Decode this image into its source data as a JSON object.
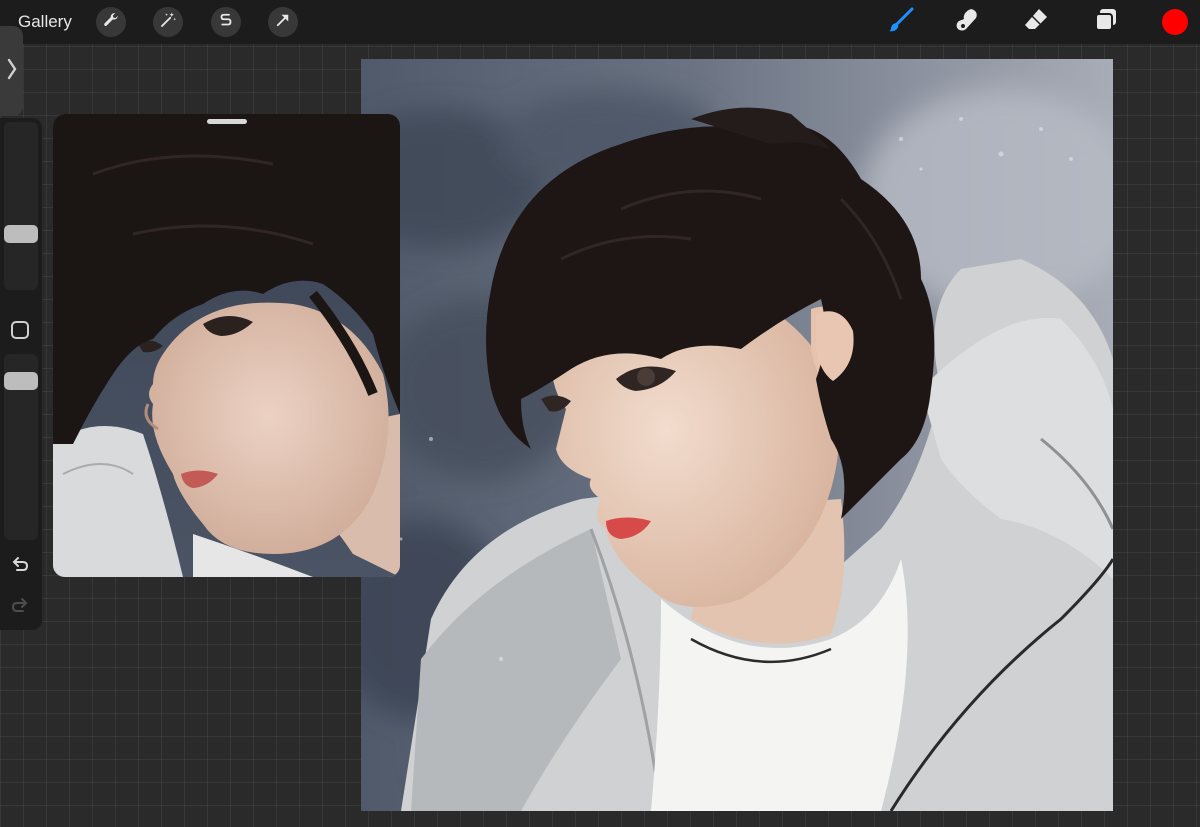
{
  "toolbar": {
    "gallery_label": "Gallery",
    "left_tools": [
      "wrench-icon",
      "magic-wand-icon",
      "selection-icon",
      "transform-arrow-icon"
    ],
    "right_tools": [
      "brush-icon",
      "smudge-icon",
      "eraser-icon",
      "layers-icon"
    ],
    "active_tool": "brush-icon",
    "accent_color": "#1e90ff",
    "current_color": "#ff0000"
  },
  "sidebar": {
    "items": [
      "brush-size-slider",
      "modify-button",
      "opacity-slider",
      "undo-icon",
      "redo-icon"
    ]
  },
  "colors": {
    "workspace_background": "#2a2a2a",
    "toolbar_background": "#1c1c1c"
  }
}
